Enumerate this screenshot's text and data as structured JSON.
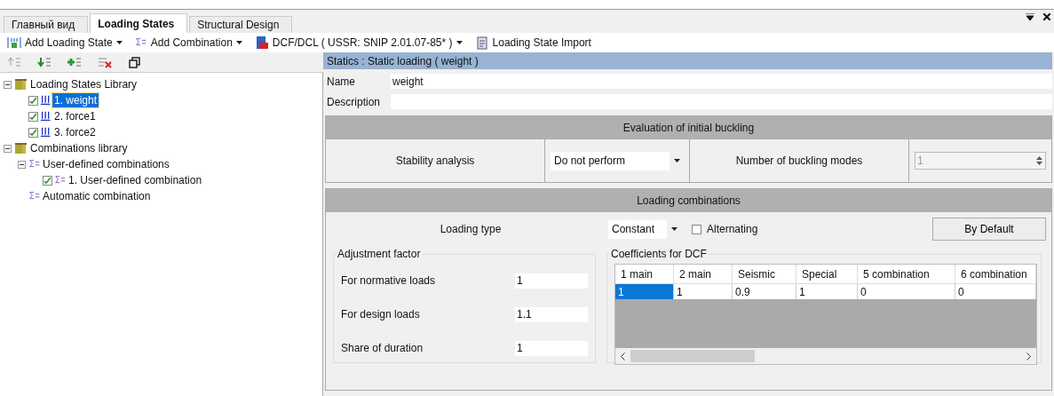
{
  "tabs": [
    {
      "label": "Главный вид",
      "selected": false
    },
    {
      "label": "Loading States",
      "selected": true
    },
    {
      "label": "Structural Design",
      "selected": false
    }
  ],
  "toolbar": [
    {
      "label": "Add Loading State",
      "dropdown": true
    },
    {
      "label": "Add Combination",
      "dropdown": true
    },
    {
      "label": "DCF/DCL ( USSR: SNIP 2.01.07-85* )",
      "dropdown": true
    },
    {
      "label": "Loading State Import",
      "dropdown": false
    }
  ],
  "tree": [
    {
      "label": "Loading States Library",
      "kind": "library",
      "expanded": true,
      "children": [
        {
          "label": "1. weight",
          "kind": "state",
          "checked": true,
          "selected": true
        },
        {
          "label": "2. force1",
          "kind": "state",
          "checked": true,
          "selected": false
        },
        {
          "label": "3. force2",
          "kind": "state",
          "checked": true,
          "selected": false
        }
      ]
    },
    {
      "label": "Combinations library",
      "kind": "library",
      "expanded": true,
      "children": [
        {
          "label": "User-defined combinations",
          "kind": "group",
          "expanded": true,
          "children": [
            {
              "label": "1. User-defined combination",
              "kind": "combination",
              "checked": true,
              "selected": false
            }
          ]
        },
        {
          "label": "Automatic combination",
          "kind": "group"
        }
      ]
    }
  ],
  "header": "Statics : Static loading ( weight )",
  "name": {
    "label": "Name",
    "value": "weight"
  },
  "description": {
    "label": "Description"
  },
  "buckling": {
    "title": "Evaluation of initial buckling",
    "stability_label": "Stability analysis",
    "stability_value": "Do not perform",
    "modes_label": "Number of buckling modes",
    "modes_value": "1",
    "modes_disabled": true
  },
  "combinations": {
    "title": "Loading combinations",
    "type_label": "Loading type",
    "type_value": "Constant",
    "alternating": {
      "label": "Alternating",
      "checked": false
    },
    "default_button": "By Default",
    "adjustment": {
      "title": "Adjustment factor",
      "rows": [
        {
          "label": "For normative loads",
          "value": "1"
        },
        {
          "label": "For design loads",
          "value": "1.1"
        },
        {
          "label": "Share of duration",
          "value": "1"
        }
      ]
    },
    "dcf": {
      "title": "Coefficients for DCF",
      "columns": [
        "1 main",
        "2 main",
        "Seismic",
        "Special",
        "5 combination",
        "6 combination"
      ],
      "cells": [
        {
          "value": "1",
          "selected": true
        },
        {
          "value": "1",
          "selected": false
        },
        {
          "value": "0.9",
          "selected": false
        },
        {
          "value": "1",
          "selected": false
        },
        {
          "value": "0",
          "selected": false
        },
        {
          "value": "0",
          "selected": false
        }
      ]
    }
  }
}
